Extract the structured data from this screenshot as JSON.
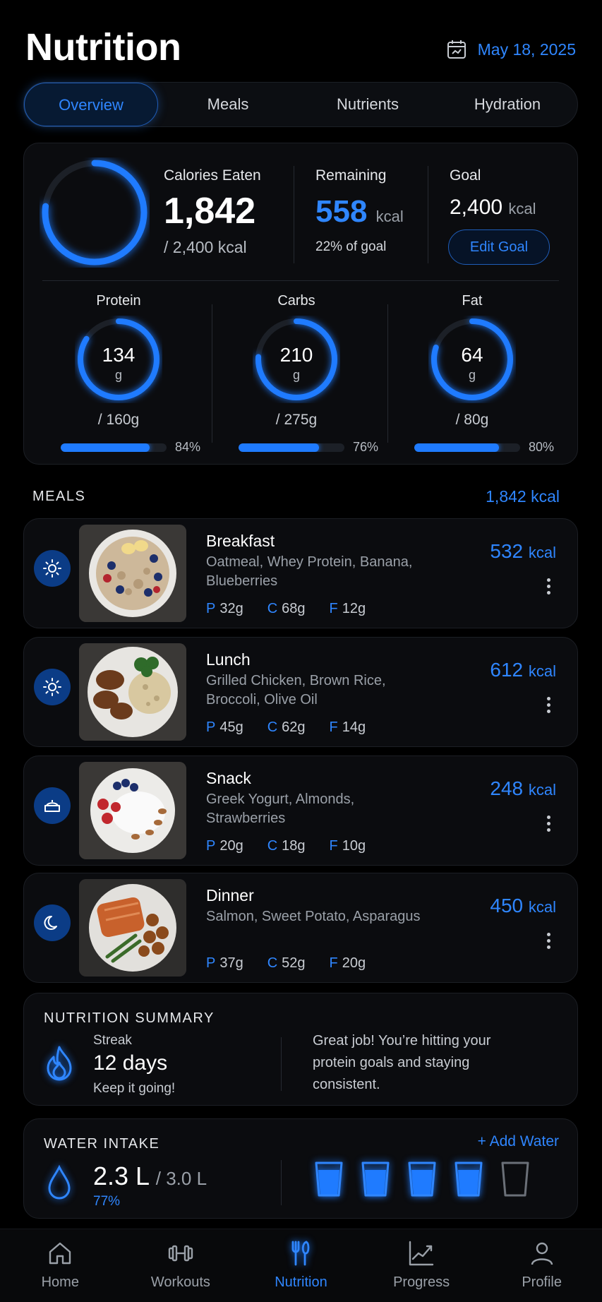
{
  "header": {
    "title": "Nutrition",
    "date": "May 18, 2025",
    "calendar_icon": "calendar-icon"
  },
  "tabs": [
    {
      "label": "Overview",
      "active": true
    },
    {
      "label": "Meals",
      "active": false
    },
    {
      "label": "Nutrients",
      "active": false
    },
    {
      "label": "Hydration",
      "active": false
    }
  ],
  "calories": {
    "eaten_label": "Calories Eaten",
    "eaten_value": "1,842",
    "eaten_of": "/ 2,400 kcal",
    "progress": 0.77,
    "remaining_label": "Remaining",
    "remaining_value": "558",
    "remaining_unit": "kcal",
    "remaining_pct": "22% of goal",
    "goal_label": "Goal",
    "goal_value": "2,400",
    "goal_unit": "kcal",
    "edit_goal": "Edit Goal"
  },
  "macros": [
    {
      "name": "Protein",
      "value": "134",
      "unit": "g",
      "of": "/ 160g",
      "pct": "84%",
      "fraction": 0.84
    },
    {
      "name": "Carbs",
      "value": "210",
      "unit": "g",
      "of": "/ 275g",
      "pct": "76%",
      "fraction": 0.76
    },
    {
      "name": "Fat",
      "value": "64",
      "unit": "g",
      "of": "/ 80g",
      "pct": "80%",
      "fraction": 0.8
    }
  ],
  "meals": {
    "section_label": "MEALS",
    "total": "1,842 kcal",
    "items": [
      {
        "name": "Breakfast",
        "desc": "Oatmeal, Whey Protein, Banana, Blueberries",
        "kcal": "532",
        "kcal_unit": "kcal",
        "p": "32g",
        "c": "68g",
        "f": "12g",
        "icon": "sun-icon"
      },
      {
        "name": "Lunch",
        "desc": "Grilled Chicken, Brown Rice, Broccoli, Olive Oil",
        "kcal": "612",
        "kcal_unit": "kcal",
        "p": "45g",
        "c": "62g",
        "f": "14g",
        "icon": "sun-icon"
      },
      {
        "name": "Snack",
        "desc": "Greek Yogurt, Almonds, Strawberries",
        "kcal": "248",
        "kcal_unit": "kcal",
        "p": "20g",
        "c": "18g",
        "f": "10g",
        "icon": "snack-icon"
      },
      {
        "name": "Dinner",
        "desc": "Salmon, Sweet Potato, Asparagus",
        "kcal": "450",
        "kcal_unit": "kcal",
        "p": "37g",
        "c": "52g",
        "f": "20g",
        "icon": "moon-icon"
      }
    ],
    "macro_keys": {
      "p": "P",
      "c": "C",
      "f": "F"
    }
  },
  "summary": {
    "title": "NUTRITION SUMMARY",
    "streak_label": "Streak",
    "streak_value": "12 days",
    "streak_sub": "Keep it going!",
    "message": "Great job! You’re hitting your protein goals and staying consistent."
  },
  "water": {
    "title": "WATER INTAKE",
    "add": "+ Add Water",
    "value": "2.3 L",
    "goal": "/ 3.0 L",
    "pct": "77%",
    "cups_filled": 4,
    "cups_total": 5
  },
  "nav": [
    {
      "label": "Home",
      "icon": "home-icon",
      "active": false
    },
    {
      "label": "Workouts",
      "icon": "dumbbell-icon",
      "active": false
    },
    {
      "label": "Nutrition",
      "icon": "utensils-icon",
      "active": true
    },
    {
      "label": "Progress",
      "icon": "chart-icon",
      "active": false
    },
    {
      "label": "Profile",
      "icon": "profile-icon",
      "active": false
    }
  ],
  "colors": {
    "accent": "#2f86ff",
    "background": "#000000",
    "card": "#0b0c0f"
  }
}
